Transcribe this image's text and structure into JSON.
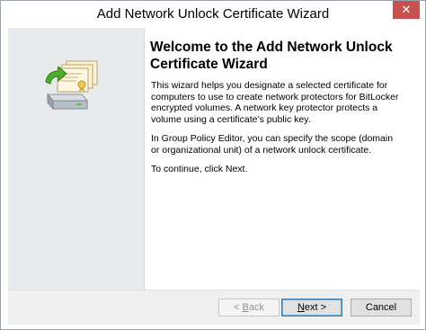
{
  "window": {
    "title": "Add Network Unlock Certificate Wizard",
    "close_label": "✕"
  },
  "content": {
    "heading": "Welcome to the Add Network Unlock Certificate Wizard",
    "paragraph1": "This wizard helps you designate a selected certificate for computers to use to create network protectors for BitLocker encrypted volumes. A network key protector protects a volume using a certificate’s public key.",
    "paragraph2": "In Group Policy Editor, you can specify the scope (domain or organizational unit) of a network unlock certificate.",
    "paragraph3": "To continue, click Next."
  },
  "buttons": {
    "back_prefix": "< ",
    "back_key": "B",
    "back_rest": "ack",
    "next_key": "N",
    "next_rest": "ext >",
    "cancel": "Cancel"
  },
  "icons": {
    "wizard_illustration": "certificate-stack-with-drive-icon",
    "close": "close-icon"
  },
  "colors": {
    "close_button": "#c75050",
    "sidebar": "#e8eaec",
    "footer": "#f0f0f0",
    "next_border": "#3c7fb1",
    "arrow_green": "#4caf2a"
  }
}
